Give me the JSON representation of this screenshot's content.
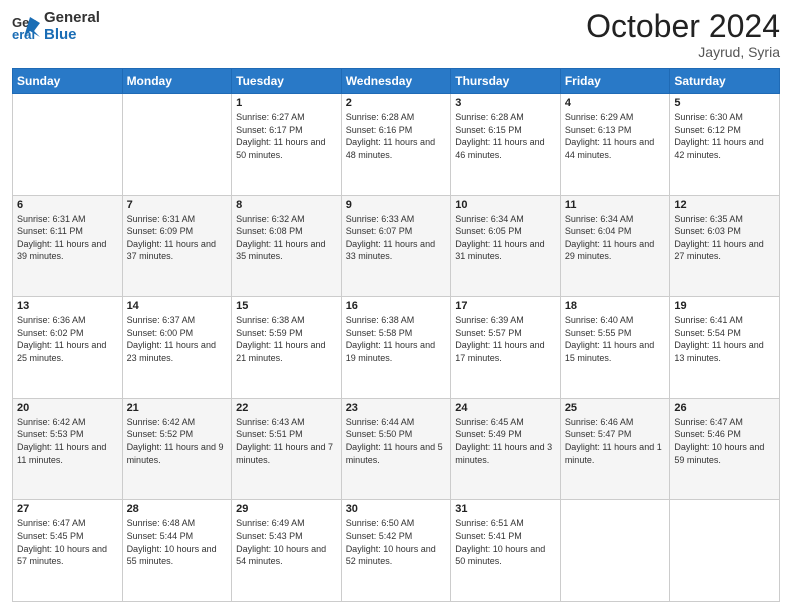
{
  "header": {
    "logo_line1": "General",
    "logo_line2": "Blue",
    "month": "October 2024",
    "location": "Jayrud, Syria"
  },
  "days_of_week": [
    "Sunday",
    "Monday",
    "Tuesday",
    "Wednesday",
    "Thursday",
    "Friday",
    "Saturday"
  ],
  "weeks": [
    [
      {
        "day": "",
        "info": ""
      },
      {
        "day": "",
        "info": ""
      },
      {
        "day": "1",
        "info": "Sunrise: 6:27 AM\nSunset: 6:17 PM\nDaylight: 11 hours and 50 minutes."
      },
      {
        "day": "2",
        "info": "Sunrise: 6:28 AM\nSunset: 6:16 PM\nDaylight: 11 hours and 48 minutes."
      },
      {
        "day": "3",
        "info": "Sunrise: 6:28 AM\nSunset: 6:15 PM\nDaylight: 11 hours and 46 minutes."
      },
      {
        "day": "4",
        "info": "Sunrise: 6:29 AM\nSunset: 6:13 PM\nDaylight: 11 hours and 44 minutes."
      },
      {
        "day": "5",
        "info": "Sunrise: 6:30 AM\nSunset: 6:12 PM\nDaylight: 11 hours and 42 minutes."
      }
    ],
    [
      {
        "day": "6",
        "info": "Sunrise: 6:31 AM\nSunset: 6:11 PM\nDaylight: 11 hours and 39 minutes."
      },
      {
        "day": "7",
        "info": "Sunrise: 6:31 AM\nSunset: 6:09 PM\nDaylight: 11 hours and 37 minutes."
      },
      {
        "day": "8",
        "info": "Sunrise: 6:32 AM\nSunset: 6:08 PM\nDaylight: 11 hours and 35 minutes."
      },
      {
        "day": "9",
        "info": "Sunrise: 6:33 AM\nSunset: 6:07 PM\nDaylight: 11 hours and 33 minutes."
      },
      {
        "day": "10",
        "info": "Sunrise: 6:34 AM\nSunset: 6:05 PM\nDaylight: 11 hours and 31 minutes."
      },
      {
        "day": "11",
        "info": "Sunrise: 6:34 AM\nSunset: 6:04 PM\nDaylight: 11 hours and 29 minutes."
      },
      {
        "day": "12",
        "info": "Sunrise: 6:35 AM\nSunset: 6:03 PM\nDaylight: 11 hours and 27 minutes."
      }
    ],
    [
      {
        "day": "13",
        "info": "Sunrise: 6:36 AM\nSunset: 6:02 PM\nDaylight: 11 hours and 25 minutes."
      },
      {
        "day": "14",
        "info": "Sunrise: 6:37 AM\nSunset: 6:00 PM\nDaylight: 11 hours and 23 minutes."
      },
      {
        "day": "15",
        "info": "Sunrise: 6:38 AM\nSunset: 5:59 PM\nDaylight: 11 hours and 21 minutes."
      },
      {
        "day": "16",
        "info": "Sunrise: 6:38 AM\nSunset: 5:58 PM\nDaylight: 11 hours and 19 minutes."
      },
      {
        "day": "17",
        "info": "Sunrise: 6:39 AM\nSunset: 5:57 PM\nDaylight: 11 hours and 17 minutes."
      },
      {
        "day": "18",
        "info": "Sunrise: 6:40 AM\nSunset: 5:55 PM\nDaylight: 11 hours and 15 minutes."
      },
      {
        "day": "19",
        "info": "Sunrise: 6:41 AM\nSunset: 5:54 PM\nDaylight: 11 hours and 13 minutes."
      }
    ],
    [
      {
        "day": "20",
        "info": "Sunrise: 6:42 AM\nSunset: 5:53 PM\nDaylight: 11 hours and 11 minutes."
      },
      {
        "day": "21",
        "info": "Sunrise: 6:42 AM\nSunset: 5:52 PM\nDaylight: 11 hours and 9 minutes."
      },
      {
        "day": "22",
        "info": "Sunrise: 6:43 AM\nSunset: 5:51 PM\nDaylight: 11 hours and 7 minutes."
      },
      {
        "day": "23",
        "info": "Sunrise: 6:44 AM\nSunset: 5:50 PM\nDaylight: 11 hours and 5 minutes."
      },
      {
        "day": "24",
        "info": "Sunrise: 6:45 AM\nSunset: 5:49 PM\nDaylight: 11 hours and 3 minutes."
      },
      {
        "day": "25",
        "info": "Sunrise: 6:46 AM\nSunset: 5:47 PM\nDaylight: 11 hours and 1 minute."
      },
      {
        "day": "26",
        "info": "Sunrise: 6:47 AM\nSunset: 5:46 PM\nDaylight: 10 hours and 59 minutes."
      }
    ],
    [
      {
        "day": "27",
        "info": "Sunrise: 6:47 AM\nSunset: 5:45 PM\nDaylight: 10 hours and 57 minutes."
      },
      {
        "day": "28",
        "info": "Sunrise: 6:48 AM\nSunset: 5:44 PM\nDaylight: 10 hours and 55 minutes."
      },
      {
        "day": "29",
        "info": "Sunrise: 6:49 AM\nSunset: 5:43 PM\nDaylight: 10 hours and 54 minutes."
      },
      {
        "day": "30",
        "info": "Sunrise: 6:50 AM\nSunset: 5:42 PM\nDaylight: 10 hours and 52 minutes."
      },
      {
        "day": "31",
        "info": "Sunrise: 6:51 AM\nSunset: 5:41 PM\nDaylight: 10 hours and 50 minutes."
      },
      {
        "day": "",
        "info": ""
      },
      {
        "day": "",
        "info": ""
      }
    ]
  ]
}
